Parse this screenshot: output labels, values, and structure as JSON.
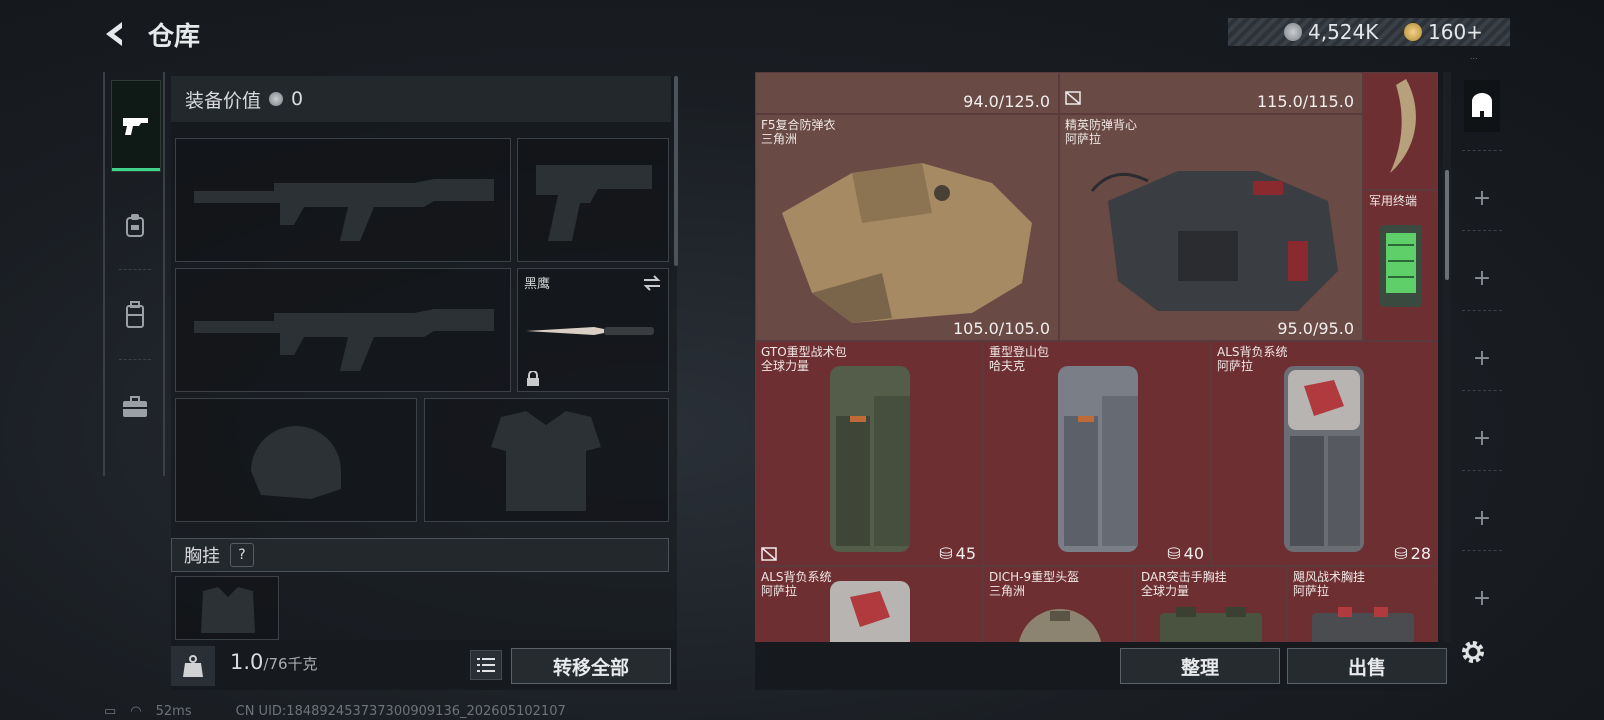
{
  "header": {
    "title": "仓库",
    "money": "4,524K",
    "coins": "160+",
    "version": "..."
  },
  "left_panel": {
    "equip_value_label": "装备价值",
    "equip_value": "0",
    "knife_slot_label": "黑鹰",
    "chest_label": "胸挂",
    "chest_help": "?",
    "weight_value": "1.0",
    "weight_max": "/76千克",
    "transfer_all": "转移全部"
  },
  "grid": {
    "top_row_durability": [
      "94.0/125.0",
      "115.0/115.0"
    ],
    "items": [
      {
        "name": "F5复合防弹衣\n三角洲",
        "durability": "105.0/105.0"
      },
      {
        "name": "精英防弹背心\n阿萨拉",
        "durability": "95.0/95.0"
      },
      {
        "name": "军用终端"
      },
      {
        "name": "GTO重型战术包\n全球力量",
        "count": "45"
      },
      {
        "name": "重型登山包\n哈夫克",
        "count": "40"
      },
      {
        "name": "ALS背负系统\n阿萨拉",
        "count": "28"
      },
      {
        "name": "ALS背负系统\n阿萨拉"
      },
      {
        "name": "DICH-9重型头盔\n三角洲"
      },
      {
        "name": "DAR突击手胸挂\n全球力量"
      },
      {
        "name": "飓风战术胸挂\n阿萨拉"
      }
    ]
  },
  "actions": {
    "sort": "整理",
    "sell": "出售"
  },
  "status": {
    "ping": "52ms",
    "uid": "CN UID:184892453737300909136_202605102107"
  },
  "colors": {
    "accent": "#3fd28a",
    "slot_red": "#6e2f33",
    "slot_brown": "#6a4a44"
  }
}
